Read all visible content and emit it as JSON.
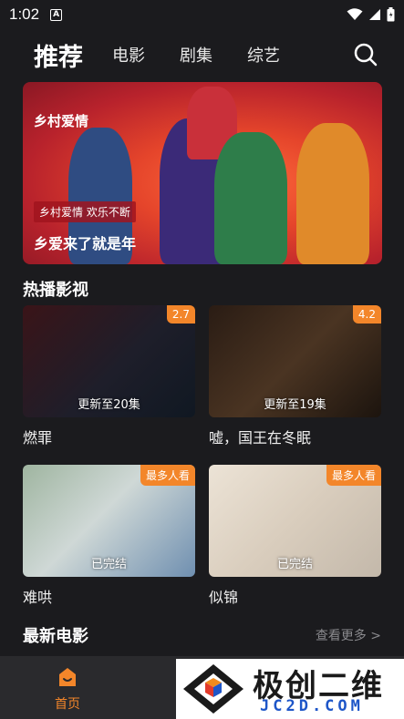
{
  "status_bar": {
    "time": "1:02",
    "notification_letter": "A"
  },
  "nav": {
    "tabs": [
      {
        "label": "推荐",
        "active": true
      },
      {
        "label": "电影",
        "active": false
      },
      {
        "label": "剧集",
        "active": false
      },
      {
        "label": "综艺",
        "active": false
      }
    ],
    "search_icon": "search-icon"
  },
  "banner": {
    "logo_text": "乡村爱情",
    "tag": "乡村爱情 欢乐不断",
    "caption": "乡爱来了就是年"
  },
  "hot_section": {
    "title": "热播影视",
    "items": [
      {
        "title": "燃罪",
        "badge": "2.7",
        "status": "更新至20集"
      },
      {
        "title": "嘘，国王在冬眠",
        "badge": "4.2",
        "status": "更新至19集"
      },
      {
        "title": "难哄",
        "badge": "最多人看",
        "status": "已完结"
      },
      {
        "title": "似锦",
        "badge": "最多人看",
        "status": "已完结"
      }
    ]
  },
  "movie_section": {
    "title": "最新电影",
    "see_more": "查看更多 >"
  },
  "bottom_tabs": [
    {
      "label": "首页",
      "active": true
    }
  ],
  "watermark": {
    "cn": "极创二维",
    "en": "JC2D.COM"
  },
  "colors": {
    "accent": "#f3862a",
    "background": "#1b1b1e",
    "tabbar": "#2a2a2d"
  }
}
